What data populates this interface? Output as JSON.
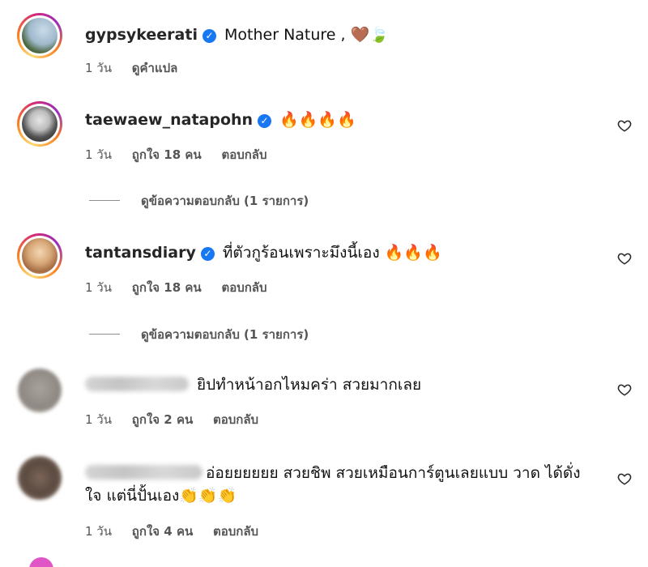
{
  "icons": {
    "verified": "verified-badge-icon",
    "like": "heart-outline-icon"
  },
  "colors": {
    "verified": "#1877f2",
    "meta_text": "#555555",
    "ring_start": "#feda75",
    "ring_end": "#962fbf"
  },
  "comments": [
    {
      "username": "gypsykeerati",
      "verified": true,
      "text": "Mother Nature ,",
      "emoji": "🤎🍃",
      "time": "1 วัน",
      "action": "ดูคำแปล"
    },
    {
      "username": "taewaew_natapohn",
      "verified": true,
      "text": "",
      "emoji": "🔥🔥🔥🔥",
      "time": "1 วัน",
      "likes": "ถูกใจ 18 คน",
      "reply": "ตอบกลับ",
      "view_replies": "ดูข้อความตอบกลับ (1 รายการ)"
    },
    {
      "username": "tantansdiary",
      "verified": true,
      "text": "ที่ตัวกูร้อนเพราะมึงนี้เอง",
      "emoji": "🔥🔥🔥",
      "time": "1 วัน",
      "likes": "ถูกใจ 18 คน",
      "reply": "ตอบกลับ",
      "view_replies": "ดูข้อความตอบกลับ (1 รายการ)"
    },
    {
      "text": "ยิปทำหน้าอกไหมคร่า สวยมากเลย",
      "time": "1 วัน",
      "likes": "ถูกใจ 2 คน",
      "reply": "ตอบกลับ"
    },
    {
      "text": "อ่อยยยยยย สวยชิพ สวยเหมือนการ์ตูนเลยแบบ วาด ได้ดั่งใจ แต่นี่ปั้นเอง",
      "emoji": "👏👏👏",
      "time": "1 วัน",
      "likes": "ถูกใจ 4 คน",
      "reply": "ตอบกลับ"
    }
  ]
}
